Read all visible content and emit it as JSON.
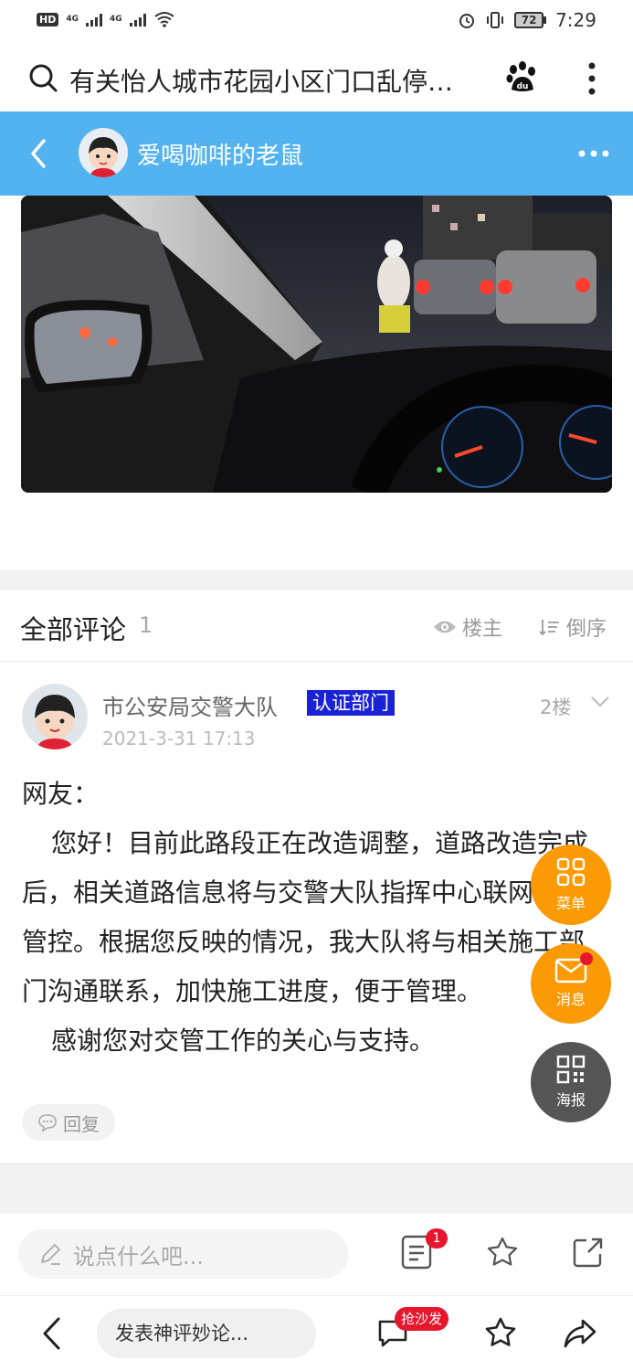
{
  "status_bar": {
    "hd": "HD",
    "network1": "4G",
    "network2": "4G",
    "battery": "72",
    "time": "7:29"
  },
  "search": {
    "query": "有关怡人城市花园小区门口乱停…"
  },
  "post_header": {
    "author": "爱喝咖啡的老鼠"
  },
  "comments": {
    "title": "全部评论",
    "count": "1",
    "op_label": "楼主",
    "order_label": "倒序"
  },
  "comment": {
    "author": "市公安局交警大队",
    "verified": "认证部门",
    "floor": "2楼",
    "time": "2021-3-31 17:13",
    "greeting": "网友：",
    "paragraph1": "您好！目前此路段正在改造调整，道路改造完成后，相关道路信息将与交警大队指挥中心联网进行管控。根据您反映的情况，我大队将与相关施工部门沟通联系，加快施工进度，便于管理。",
    "paragraph2": "感谢您对交管工作的关心与支持。",
    "reply_label": "回复"
  },
  "floating": {
    "menu": "菜单",
    "message": "消息",
    "poster": "海报"
  },
  "input_bar": {
    "placeholder": "说点什么吧...",
    "comment_badge": "1"
  },
  "browser_bar": {
    "placeholder": "发表神评妙论...",
    "hot_badge": "抢沙发"
  },
  "colors": {
    "header_blue": "#53b2f0",
    "float_orange": "#fb9a05",
    "float_gray": "#555555",
    "badge_red": "#e6162d",
    "verified_blue": "#1a22d8"
  }
}
